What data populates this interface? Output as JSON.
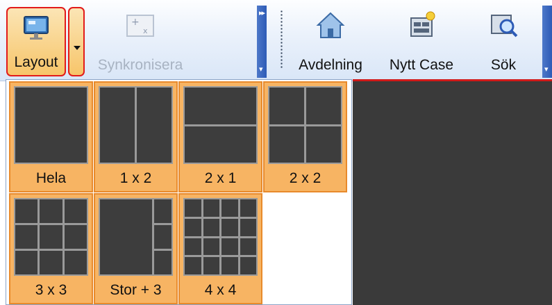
{
  "toolbar": {
    "layout_label": "Layout",
    "sync_label": "Synkronisera",
    "avdelning_label": "Avdelning",
    "nytt_case_label": "Nytt Case",
    "sok_label": "Sök"
  },
  "layouts": [
    {
      "label": "Hela"
    },
    {
      "label": "1 x 2"
    },
    {
      "label": "2 x 1"
    },
    {
      "label": "2 x 2"
    },
    {
      "label": "3 x 3"
    },
    {
      "label": "Stor + 3"
    },
    {
      "label": "4 x 4"
    }
  ],
  "colors": {
    "highlight_border": "#e21a1a",
    "tile_fill": "#f7b463",
    "tile_border": "#e88a2b",
    "dark_workspace": "#3a3a3a"
  },
  "icons": [
    "monitor-icon",
    "chevron-down-icon",
    "add-window-icon",
    "home-icon",
    "new-case-icon",
    "search-icon"
  ]
}
